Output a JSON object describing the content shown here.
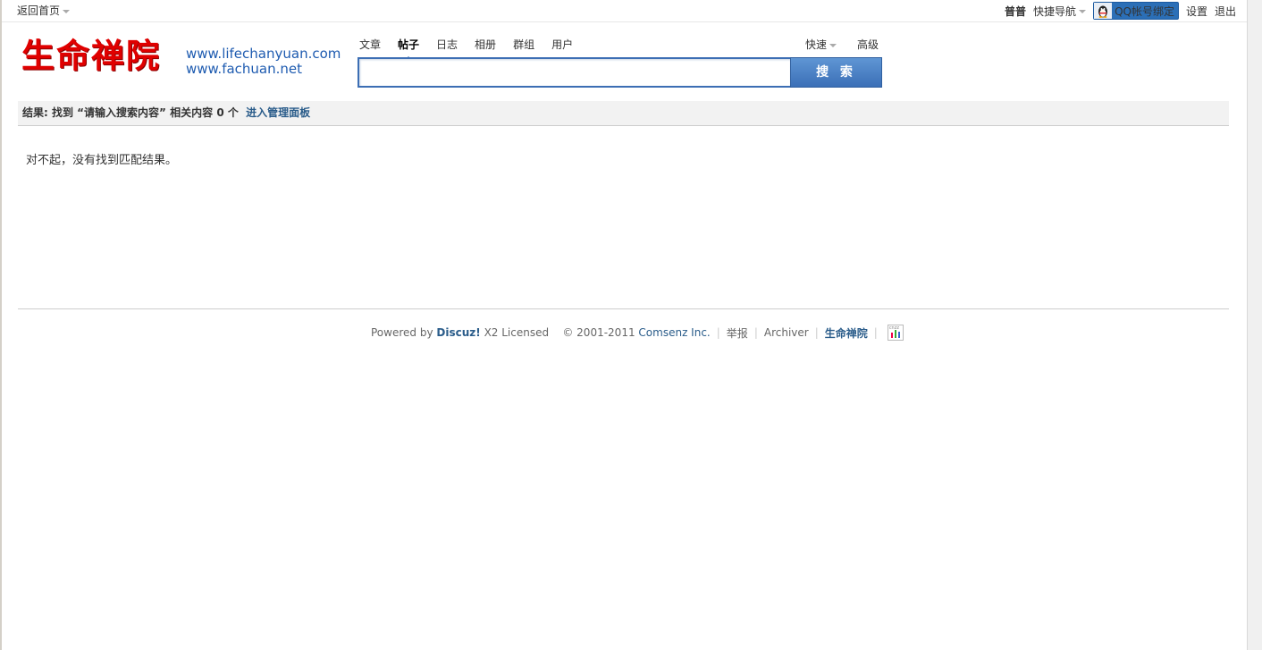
{
  "topbar": {
    "home_link": "返回首页",
    "username": "普普",
    "quick_nav": "快捷导航",
    "qq_bind": "QQ帐号绑定",
    "settings": "设置",
    "logout": "退出"
  },
  "logo": {
    "text": "生命禅院",
    "url1": "www.lifechanyuan.com",
    "url2": "www.fachuan.net"
  },
  "search": {
    "tabs": [
      {
        "label": "文章"
      },
      {
        "label": "帖子",
        "active": true
      },
      {
        "label": "日志"
      },
      {
        "label": "相册"
      },
      {
        "label": "群组"
      },
      {
        "label": "用户"
      }
    ],
    "quick": "快速",
    "advanced": "高级",
    "input_value": "",
    "button_label": "搜 索"
  },
  "result": {
    "prefix": "结果: 找到",
    "query": "“请输入搜索内容”",
    "middle": "相关内容",
    "count": "0 个",
    "admin_link": "进入管理面板",
    "no_result_text": "对不起，没有找到匹配结果。"
  },
  "footer": {
    "powered_by": "Powered by",
    "discuz": "Discuz!",
    "version": "X2 Licensed",
    "copyright": "© 2001-2011",
    "company": "Comsenz Inc.",
    "report": "举报",
    "archiver": "Archiver",
    "site_name": "生命禅院",
    "stats_icon_text": "cnzz"
  }
}
